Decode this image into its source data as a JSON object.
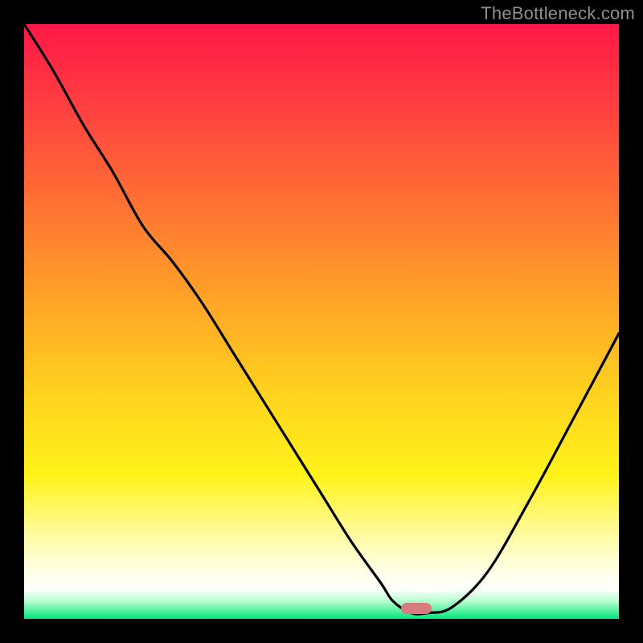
{
  "watermark": {
    "text": "TheBottleneck.com"
  },
  "colors": {
    "frame": "#000000",
    "curve": "#000000",
    "marker": "#d87a7e",
    "gradient_stops": [
      "#ff1846",
      "#ff3a42",
      "#ff6a35",
      "#ffa028",
      "#ffd21f",
      "#fff31a",
      "#fffcb0",
      "#ffffe6",
      "#ffffff",
      "#b7ffce",
      "#00e67a"
    ]
  },
  "marker": {
    "x_pct": 66,
    "y_pct": 98.3
  },
  "chart_data": {
    "type": "line",
    "title": "",
    "xlabel": "",
    "ylabel": "",
    "xlim": [
      0,
      100
    ],
    "ylim": [
      0,
      100
    ],
    "series": [
      {
        "name": "bottleneck-curve",
        "x": [
          0,
          5,
          10,
          15,
          20,
          25,
          30,
          35,
          40,
          45,
          50,
          55,
          60,
          62,
          65,
          68,
          72,
          78,
          85,
          92,
          100
        ],
        "y": [
          0,
          8,
          17,
          25,
          34,
          40,
          47,
          55,
          63,
          71,
          79,
          87,
          94,
          97,
          99,
          99,
          98,
          92,
          80,
          67,
          52
        ]
      }
    ],
    "annotations": [
      {
        "kind": "pill-marker",
        "x": 66,
        "y": 98.3
      }
    ]
  }
}
